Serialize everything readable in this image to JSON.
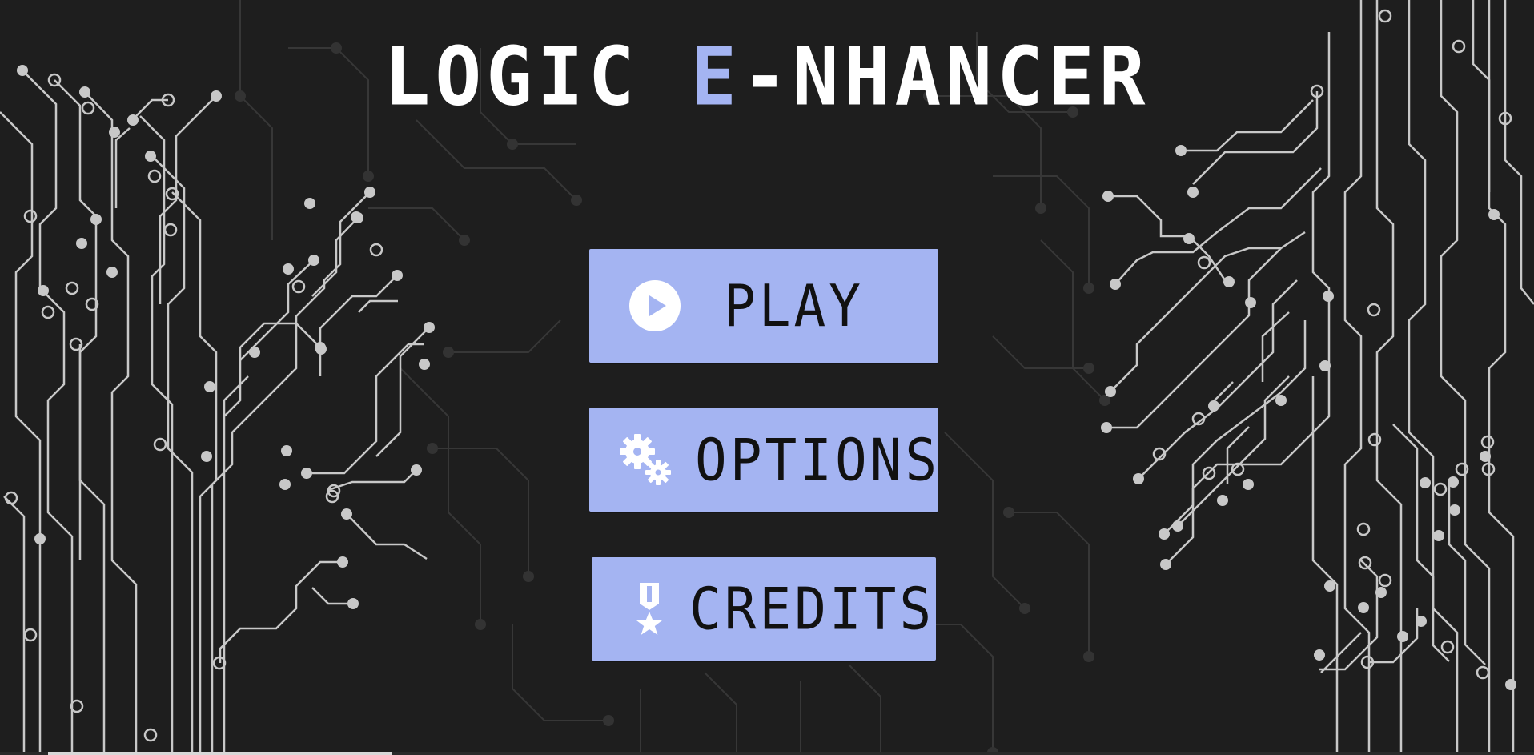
{
  "title": {
    "part1": "LOGIC ",
    "accent": "E",
    "part2": "-NHANCER"
  },
  "menu": {
    "play": {
      "label": "PLAY",
      "icon": "play-circle-icon"
    },
    "options": {
      "label": "OPTIONS",
      "icon": "gears-icon"
    },
    "credits": {
      "label": "CREDITS",
      "icon": "medal-icon"
    }
  },
  "colors": {
    "background": "#1e1e1e",
    "accent": "#a4b4f2",
    "title": "#ffffff",
    "circuit_bright": "#c8c8c8",
    "circuit_dim": "#3a3a3a",
    "button_text": "#111111"
  }
}
